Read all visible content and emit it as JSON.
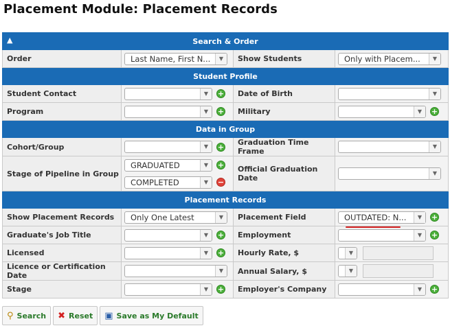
{
  "title": "Placement Module: Placement Records",
  "sections": {
    "search_order": "Search & Order",
    "student_profile": "Student Profile",
    "data_in_group": "Data in Group",
    "placement_records": "Placement Records"
  },
  "icons": {
    "collapse": "chevron-up-icon",
    "dropdown": "dropdown-arrow-icon",
    "add": "plus-circle-icon",
    "remove": "minus-circle-icon"
  },
  "colors": {
    "section_header": "#1a6bb5",
    "add": "#4caf3b",
    "remove": "#e0433a",
    "button_text": "#2a7a2a"
  },
  "fields": {
    "order": {
      "label": "Order",
      "value": "Last Name, First N..."
    },
    "show_students": {
      "label": "Show Students",
      "value": "Only with Placem..."
    },
    "student_contact": {
      "label": "Student Contact",
      "value": ""
    },
    "date_of_birth": {
      "label": "Date of Birth",
      "value": ""
    },
    "program": {
      "label": "Program",
      "value": ""
    },
    "military": {
      "label": "Military",
      "value": ""
    },
    "cohort_group": {
      "label": "Cohort/Group",
      "value": ""
    },
    "graduation_time_frame": {
      "label": "Graduation Time Frame",
      "value": ""
    },
    "stage_of_pipeline": {
      "label": "Stage of Pipeline in Group",
      "values": [
        "GRADUATED",
        "COMPLETED"
      ]
    },
    "official_graduation_date": {
      "label": "Official Graduation Date",
      "value": ""
    },
    "show_placement_records": {
      "label": "Show Placement Records",
      "value": "Only One Latest"
    },
    "placement_field": {
      "label": "Placement Field",
      "value": "OUTDATED: N..."
    },
    "graduates_job_title": {
      "label": "Graduate's Job Title",
      "value": ""
    },
    "employment": {
      "label": "Employment",
      "value": ""
    },
    "licensed": {
      "label": "Licensed",
      "value": ""
    },
    "hourly_rate": {
      "label": "Hourly Rate, $",
      "value": ""
    },
    "licence_date": {
      "label": "Licence or Certification Date",
      "value": ""
    },
    "annual_salary": {
      "label": "Annual Salary, $",
      "value": ""
    },
    "stage": {
      "label": "Stage",
      "value": ""
    },
    "employers_company": {
      "label": "Employer's Company",
      "value": ""
    }
  },
  "buttons": {
    "search": "Search",
    "reset": "Reset",
    "save_default": "Save as My Default"
  }
}
